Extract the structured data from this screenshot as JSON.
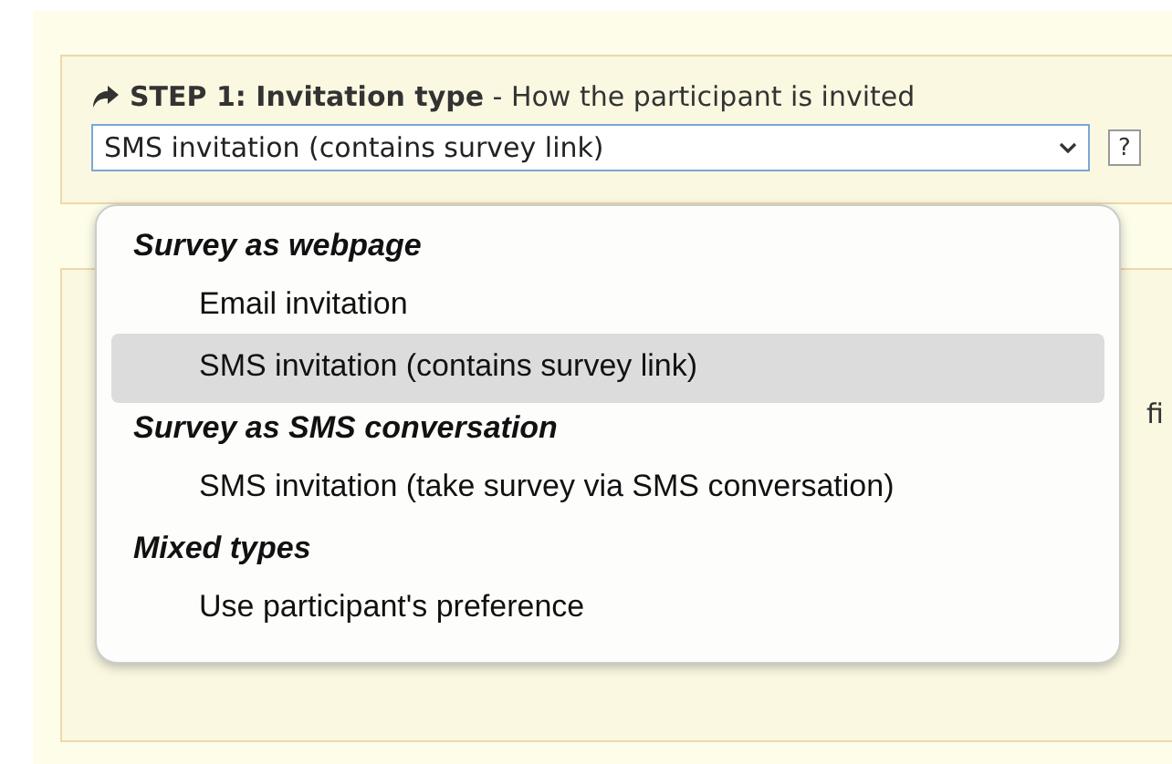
{
  "step": {
    "title": "STEP 1: Invitation type",
    "description": "- How the participant is invited"
  },
  "select": {
    "value": "SMS invitation (contains survey link)",
    "help": "?"
  },
  "dropdown": {
    "groups": [
      {
        "label": "Survey as webpage",
        "options": [
          {
            "label": "Email invitation",
            "selected": false
          },
          {
            "label": "SMS invitation (contains survey link)",
            "selected": true
          }
        ]
      },
      {
        "label": "Survey as SMS conversation",
        "options": [
          {
            "label": "SMS invitation (take survey via SMS conversation)",
            "selected": false
          }
        ]
      },
      {
        "label": "Mixed types",
        "options": [
          {
            "label": "Use participant's preference",
            "selected": false
          }
        ]
      }
    ]
  },
  "next_panel": {
    "partial_text": "fi"
  }
}
